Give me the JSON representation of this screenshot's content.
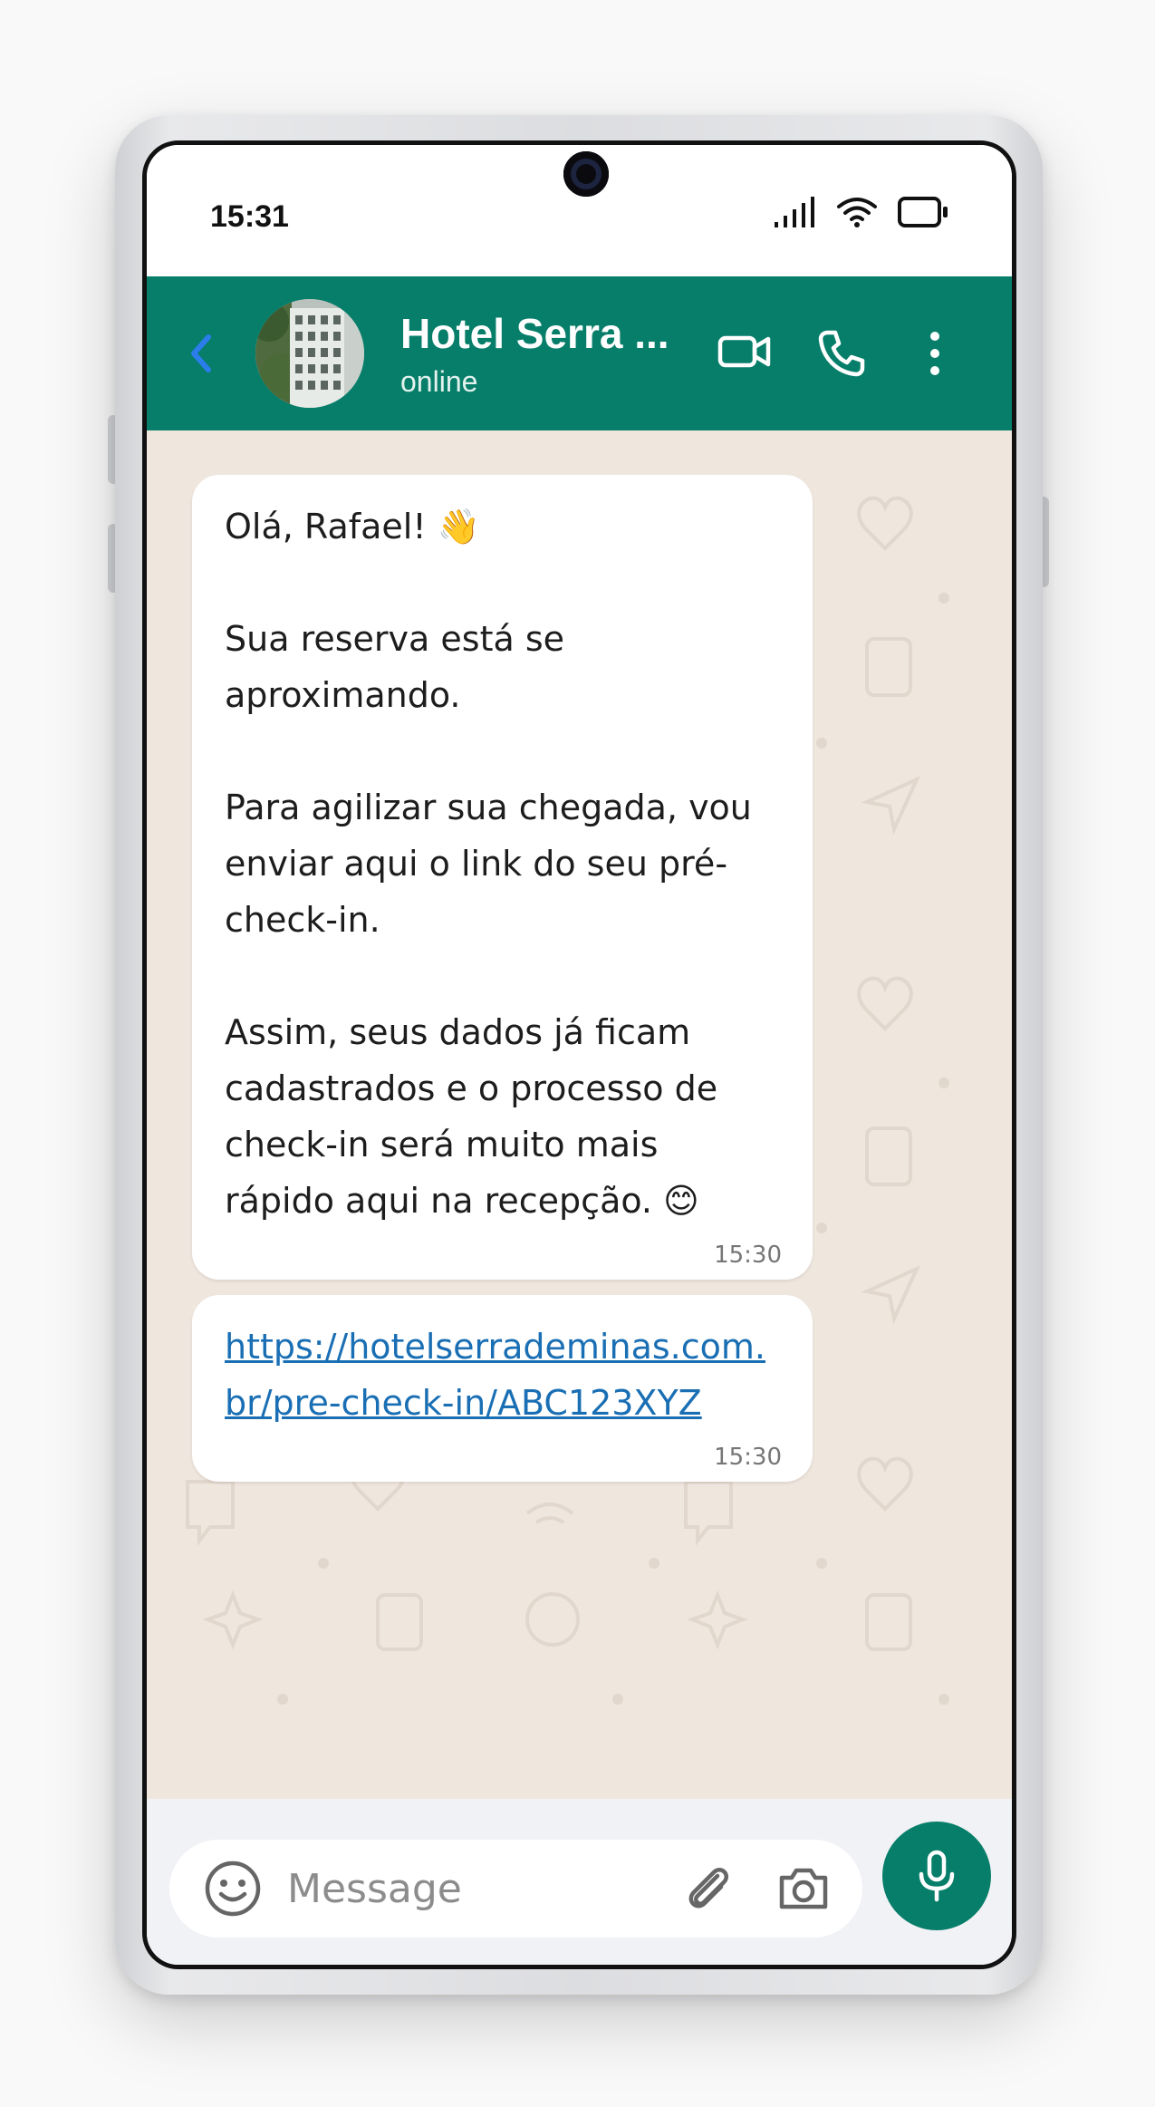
{
  "status_bar": {
    "time": "15:31",
    "icons": [
      "signal-icon",
      "wifi-icon",
      "battery-icon"
    ]
  },
  "header": {
    "contact_name": "Hotel Serra ...",
    "contact_status": "online",
    "actions": [
      "back-icon",
      "video-call-icon",
      "voice-call-icon",
      "more-options-icon"
    ]
  },
  "messages": [
    {
      "text": "Olá, Rafael! 👋\n\nSua reserva está se\naproximando.\n\nPara agilizar sua chegada, vou\nenviar aqui o link do seu pré-\ncheck-in.\n\nAssim, seus dados já ficam\ncadastrados e o processo de\ncheck-in será muito mais\nrápido aqui na recepção. 😊",
      "time": "15:30"
    },
    {
      "link": "https://hotelserrademinas.com.br/pre-check-in/ABC123XYZ",
      "time": "15:30"
    }
  ],
  "composer": {
    "placeholder": "Message",
    "value": ""
  },
  "colors": {
    "header": "#077e6a",
    "chat_background": "#efe6de",
    "link": "#1a6fb4",
    "back_arrow": "#2b7de9"
  }
}
